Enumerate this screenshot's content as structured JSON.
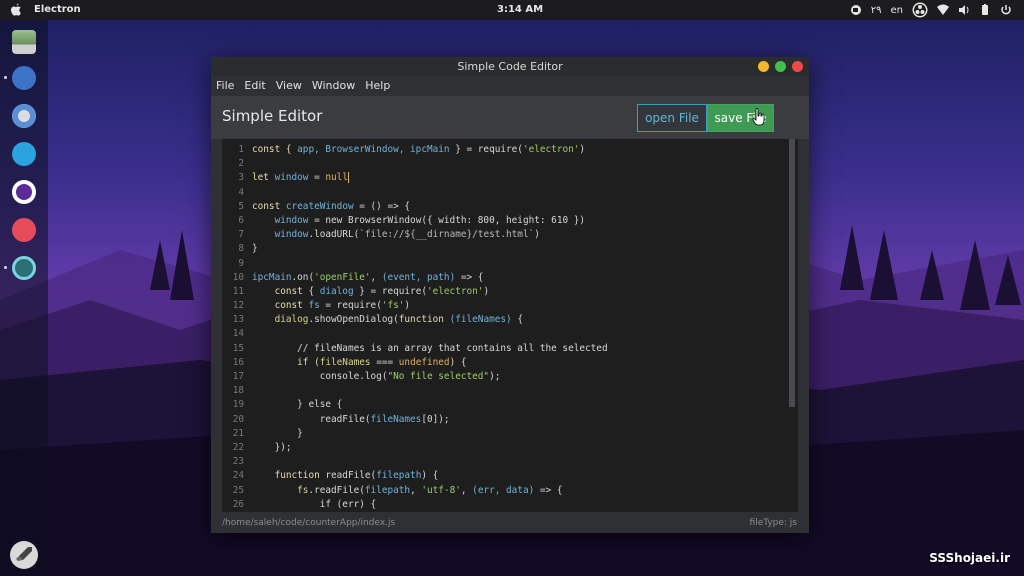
{
  "topbar": {
    "app_name": "Electron",
    "clock": "3:14 AM",
    "tray": {
      "date_text": "۲۹",
      "lang": "en"
    }
  },
  "window": {
    "title": "Simple Code Editor",
    "menu": [
      "File",
      "Edit",
      "View",
      "Window",
      "Help"
    ],
    "header_title": "Simple Editor",
    "open_button": "open File",
    "save_button": "save File",
    "status_path": "/home/saleh/code/counterApp/index.js",
    "status_filetype": "fileType: js"
  },
  "editor": {
    "lines": [
      {
        "n": "1",
        "tokens": [
          {
            "t": "const { ",
            "c": "kw"
          },
          {
            "t": "app, BrowserWindow, ipcMain",
            "c": "var"
          },
          {
            "t": " } = require(",
            "c": "plain"
          },
          {
            "t": "'electron'",
            "c": "str"
          },
          {
            "t": ")",
            "c": "plain"
          }
        ]
      },
      {
        "n": "2",
        "tokens": []
      },
      {
        "n": "3",
        "tokens": [
          {
            "t": "let ",
            "c": "kw"
          },
          {
            "t": "window",
            "c": "var"
          },
          {
            "t": " = ",
            "c": "plain"
          },
          {
            "t": "null",
            "c": "lit"
          }
        ],
        "caret": true
      },
      {
        "n": "4",
        "tokens": []
      },
      {
        "n": "5",
        "tokens": [
          {
            "t": "const ",
            "c": "kw"
          },
          {
            "t": "createWindow",
            "c": "var"
          },
          {
            "t": " = () => {",
            "c": "plain"
          }
        ]
      },
      {
        "n": "6",
        "tokens": [
          {
            "t": "    window",
            "c": "var"
          },
          {
            "t": " = new BrowserWindow({ width: ",
            "c": "plain"
          },
          {
            "t": "800",
            "c": "plain"
          },
          {
            "t": ", height: ",
            "c": "plain"
          },
          {
            "t": "610",
            "c": "plain"
          },
          {
            "t": " })",
            "c": "plain"
          }
        ]
      },
      {
        "n": "7",
        "tokens": [
          {
            "t": "    window",
            "c": "var"
          },
          {
            "t": ".loadURL(",
            "c": "plain"
          },
          {
            "t": "`file://${__dirname}/test.html`",
            "c": "str2"
          },
          {
            "t": ")",
            "c": "plain"
          }
        ]
      },
      {
        "n": "8",
        "tokens": [
          {
            "t": "}",
            "c": "plain"
          }
        ]
      },
      {
        "n": "9",
        "tokens": []
      },
      {
        "n": "10",
        "tokens": [
          {
            "t": "ipcMain",
            "c": "var"
          },
          {
            "t": ".on(",
            "c": "plain"
          },
          {
            "t": "'openFile'",
            "c": "str"
          },
          {
            "t": ", ",
            "c": "plain"
          },
          {
            "t": "(event, path)",
            "c": "var"
          },
          {
            "t": " => {",
            "c": "plain"
          }
        ]
      },
      {
        "n": "11",
        "tokens": [
          {
            "t": "    const { ",
            "c": "kw"
          },
          {
            "t": "dialog",
            "c": "var"
          },
          {
            "t": " } = require(",
            "c": "plain"
          },
          {
            "t": "'electron'",
            "c": "str"
          },
          {
            "t": ")",
            "c": "plain"
          }
        ]
      },
      {
        "n": "12",
        "tokens": [
          {
            "t": "    const ",
            "c": "kw"
          },
          {
            "t": "fs",
            "c": "var"
          },
          {
            "t": " = require(",
            "c": "plain"
          },
          {
            "t": "'fs'",
            "c": "str"
          },
          {
            "t": ")",
            "c": "plain"
          }
        ]
      },
      {
        "n": "13",
        "tokens": [
          {
            "t": "    dialog",
            "c": "var2"
          },
          {
            "t": ".showOpenDialog(",
            "c": "plain"
          },
          {
            "t": "function ",
            "c": "kw"
          },
          {
            "t": "(fileNames)",
            "c": "var"
          },
          {
            "t": " {",
            "c": "plain"
          }
        ]
      },
      {
        "n": "14",
        "tokens": []
      },
      {
        "n": "15",
        "tokens": [
          {
            "t": "        // fileNames is an array that contains all the selected",
            "c": "comment"
          }
        ]
      },
      {
        "n": "16",
        "tokens": [
          {
            "t": "        if (",
            "c": "kw"
          },
          {
            "t": "fileNames",
            "c": "var2"
          },
          {
            "t": " === ",
            "c": "plain"
          },
          {
            "t": "undefined",
            "c": "lit"
          },
          {
            "t": ") {",
            "c": "plain"
          }
        ]
      },
      {
        "n": "17",
        "tokens": [
          {
            "t": "            console",
            "c": "plain"
          },
          {
            "t": ".log(",
            "c": "plain"
          },
          {
            "t": "\"No file selected\"",
            "c": "str"
          },
          {
            "t": ");",
            "c": "plain"
          }
        ]
      },
      {
        "n": "18",
        "tokens": []
      },
      {
        "n": "19",
        "tokens": [
          {
            "t": "        } else {",
            "c": "plain"
          }
        ]
      },
      {
        "n": "20",
        "tokens": [
          {
            "t": "            readFile(",
            "c": "plain"
          },
          {
            "t": "fileNames",
            "c": "var"
          },
          {
            "t": "[0]);",
            "c": "plain"
          }
        ]
      },
      {
        "n": "21",
        "tokens": [
          {
            "t": "        }",
            "c": "plain"
          }
        ]
      },
      {
        "n": "22",
        "tokens": [
          {
            "t": "    });",
            "c": "plain"
          }
        ]
      },
      {
        "n": "23",
        "tokens": []
      },
      {
        "n": "24",
        "tokens": [
          {
            "t": "    function ",
            "c": "kw"
          },
          {
            "t": "readFile(",
            "c": "plain"
          },
          {
            "t": "filepath",
            "c": "var"
          },
          {
            "t": ") {",
            "c": "plain"
          }
        ]
      },
      {
        "n": "25",
        "tokens": [
          {
            "t": "        fs",
            "c": "var2"
          },
          {
            "t": ".readFile(",
            "c": "plain"
          },
          {
            "t": "filepath",
            "c": "var"
          },
          {
            "t": ", ",
            "c": "plain"
          },
          {
            "t": "'utf-8'",
            "c": "str"
          },
          {
            "t": ", ",
            "c": "plain"
          },
          {
            "t": "(err, data)",
            "c": "var"
          },
          {
            "t": " => {",
            "c": "plain"
          }
        ]
      },
      {
        "n": "26",
        "tokens": [
          {
            "t": "            if (err) {",
            "c": "plain"
          }
        ]
      }
    ]
  },
  "colors": {
    "kw": "#e6dbb0",
    "var": "#6fb3d9",
    "var2": "#d6d18a",
    "str": "#9ccc65",
    "str2": "#b8b8b8",
    "lit": "#e0b060",
    "comment": "#d7d7d7",
    "plain": "#d7d7d7"
  },
  "watermark": "SSShojaei.ir"
}
